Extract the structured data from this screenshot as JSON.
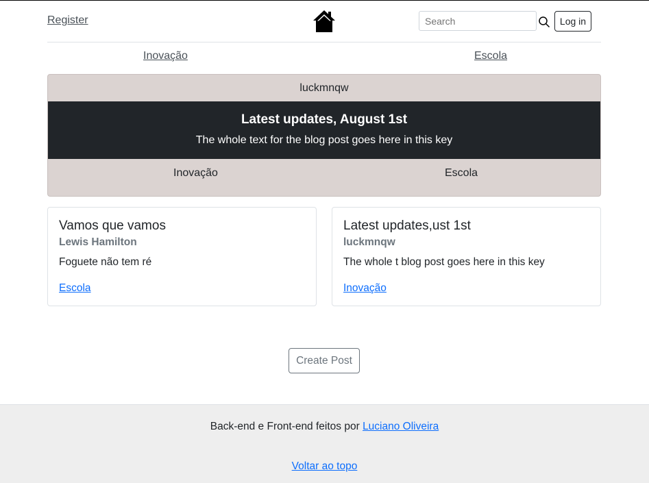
{
  "header": {
    "register_label": "Register",
    "home_icon": "house-icon",
    "search_placeholder": "Search",
    "search_icon": "magnifier-icon",
    "login_label": "Log in"
  },
  "nav": {
    "items": [
      "Inovação",
      "Escola"
    ]
  },
  "featured": {
    "author": "luckmnqw",
    "title": "Latest updates, August 1st",
    "text": "The whole text for the blog post goes here in this key",
    "categories": [
      "Inovação",
      "Escola"
    ]
  },
  "posts": [
    {
      "title": "Vamos que vamos",
      "author": "Lewis Hamilton",
      "text": "Foguete não tem ré",
      "category": "Escola"
    },
    {
      "title": "Latest updates,ust 1st",
      "author": "luckmnqw",
      "text": "The whole t blog post goes here in this key",
      "category": "Inovação"
    }
  ],
  "create_post_label": "Create Post",
  "footer": {
    "prefix": "Back-end e Front-end feitos por",
    "author_link": "Luciano Oliveira",
    "back_to_top": "Voltar ao topo"
  },
  "colors": {
    "featured_bg": "#dbd3d1",
    "dark_band": "#212529",
    "link": "#0d6efd",
    "footer_bg": "#eeeeee"
  }
}
